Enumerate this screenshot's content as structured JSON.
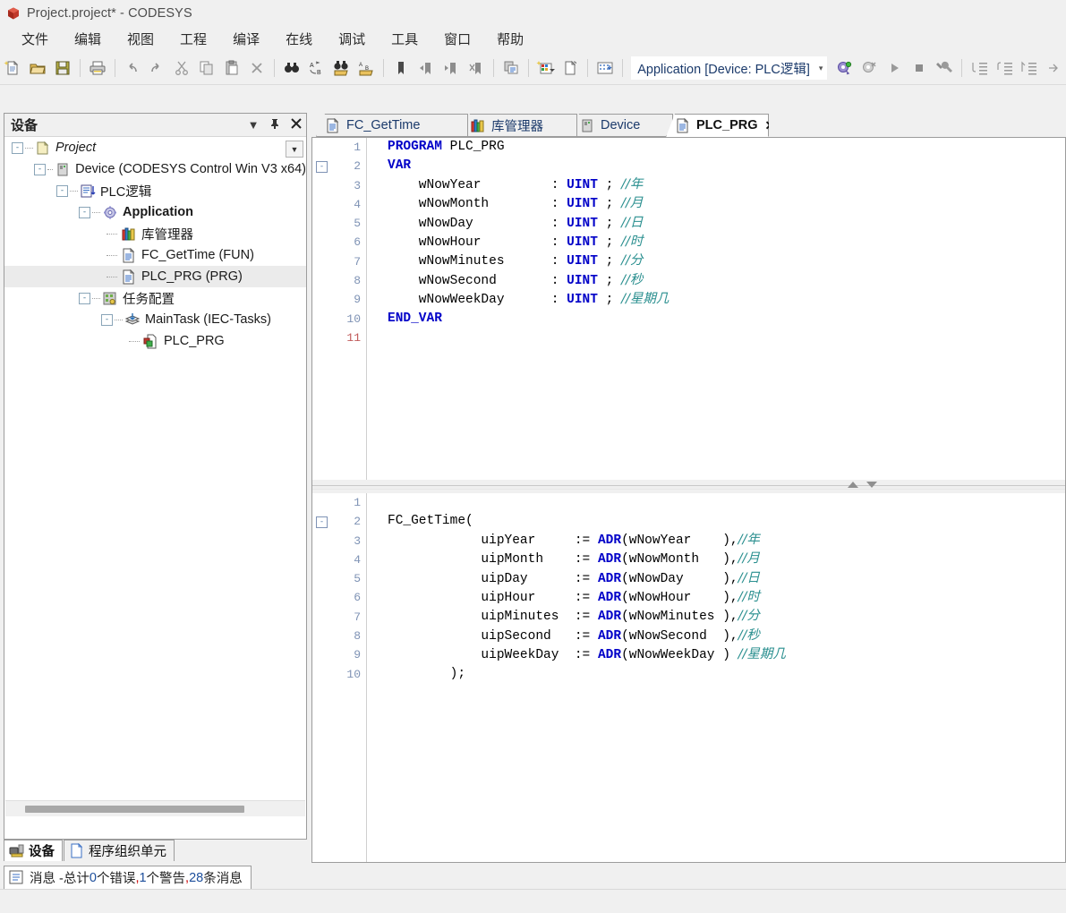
{
  "window": {
    "title": "Project.project* - CODESYS",
    "icon": "codesys-logo-icon"
  },
  "menu": {
    "items": [
      {
        "label": "文件",
        "name": "menu-file"
      },
      {
        "label": "编辑",
        "name": "menu-edit"
      },
      {
        "label": "视图",
        "name": "menu-view"
      },
      {
        "label": "工程",
        "name": "menu-project"
      },
      {
        "label": "编译",
        "name": "menu-build"
      },
      {
        "label": "在线",
        "name": "menu-online"
      },
      {
        "label": "调试",
        "name": "menu-debug"
      },
      {
        "label": "工具",
        "name": "menu-tools"
      },
      {
        "label": "窗口",
        "name": "menu-window"
      },
      {
        "label": "帮助",
        "name": "menu-help"
      }
    ]
  },
  "toolbar": {
    "application_selector": "Application [Device: PLC逻辑]",
    "caret": "▾",
    "buttons": [
      "new-project-icon",
      "open-project-icon",
      "save-project-icon",
      "print-icon",
      "undo-icon",
      "redo-icon",
      "cut-icon",
      "copy-icon",
      "paste-icon",
      "delete-icon",
      "find-icon",
      "replace-icon",
      "find-next-icon",
      "find-prev-icon",
      "toggle-bookmark-icon",
      "next-bookmark-icon",
      "prev-bookmark-icon",
      "clear-bookmarks-icon",
      "paste-special-icon",
      "new-object-icon",
      "new-folder-icon",
      "display-mode-icon",
      "login-icon",
      "logout-icon",
      "start-icon",
      "stop-icon",
      "build-icon",
      "step-into-icon",
      "step-over-icon",
      "step-out-icon"
    ]
  },
  "devices_panel": {
    "title": "设备",
    "header_buttons": [
      "dropdown-icon",
      "pin-icon",
      "close-icon"
    ],
    "tree": [
      {
        "label": "Project",
        "icon": "project-icon",
        "indent": 0,
        "expander": "-",
        "style": "italic",
        "name": "tree-item-project"
      },
      {
        "label": "Device (CODESYS Control Win V3 x64)",
        "icon": "device-icon",
        "indent": 1,
        "expander": "-",
        "style": "normal",
        "name": "tree-item-device"
      },
      {
        "label": "PLC逻辑",
        "icon": "plc-logic-icon",
        "indent": 2,
        "expander": "-",
        "style": "normal",
        "name": "tree-item-plc-logic"
      },
      {
        "label": "Application",
        "icon": "application-icon",
        "indent": 3,
        "expander": "-",
        "style": "bold",
        "name": "tree-item-application"
      },
      {
        "label": "库管理器",
        "icon": "library-manager-icon",
        "indent": 4,
        "expander": "",
        "style": "normal",
        "name": "tree-item-library-manager"
      },
      {
        "label": "FC_GetTime (FUN)",
        "icon": "function-icon",
        "indent": 4,
        "expander": "",
        "style": "normal",
        "name": "tree-item-fc-gettime"
      },
      {
        "label": "PLC_PRG (PRG)",
        "icon": "program-icon",
        "indent": 4,
        "expander": "",
        "style": "normal",
        "selected": true,
        "name": "tree-item-plc-prg"
      },
      {
        "label": "任务配置",
        "icon": "task-config-icon",
        "indent": 3,
        "expander": "-",
        "style": "normal",
        "name": "tree-item-task-config"
      },
      {
        "label": "MainTask (IEC-Tasks)",
        "icon": "task-icon",
        "indent": 4,
        "expander": "-",
        "style": "normal",
        "name": "tree-item-maintask"
      },
      {
        "label": "PLC_PRG",
        "icon": "task-call-icon",
        "indent": 5,
        "expander": "",
        "style": "normal",
        "name": "tree-item-maintask-plc-prg"
      }
    ]
  },
  "dock_tabs": [
    {
      "label": "设备",
      "icon": "devices-icon",
      "active": true,
      "name": "dock-tab-devices"
    },
    {
      "label": "程序组织单元",
      "icon": "pou-icon",
      "active": false,
      "name": "dock-tab-pou"
    }
  ],
  "messages_tab": {
    "icon": "messages-icon",
    "prefix": "消息 -总计 ",
    "errors": "0",
    "errors_suffix": "个错误",
    "sep1": ",",
    "warnings": "1",
    "warnings_suffix": "个警告",
    "sep2": ",",
    "messages": "28",
    "messages_suffix": "条消息"
  },
  "editor": {
    "tabs": [
      {
        "label": "FC_GetTime",
        "icon": "function-icon",
        "active": false,
        "closable": false,
        "name": "editor-tab-fc-gettime"
      },
      {
        "label": "库管理器",
        "icon": "library-manager-icon",
        "active": false,
        "closable": false,
        "name": "editor-tab-library-manager"
      },
      {
        "label": "Device",
        "icon": "device-icon",
        "active": false,
        "closable": false,
        "name": "editor-tab-device"
      },
      {
        "label": "PLC_PRG",
        "icon": "program-icon",
        "active": true,
        "closable": true,
        "close_label": "✕",
        "name": "editor-tab-plc-prg"
      }
    ],
    "declaration": {
      "fold_marker": "-",
      "fold_line": 2,
      "current_line": 11,
      "lines": [
        {
          "n": "1",
          "tokens": [
            {
              "t": "k",
              "v": "PROGRAM"
            },
            {
              "t": "id",
              "v": " PLC_PRG"
            }
          ]
        },
        {
          "n": "2",
          "tokens": [
            {
              "t": "k",
              "v": "VAR"
            }
          ]
        },
        {
          "n": "3",
          "tokens": [
            {
              "t": "id",
              "v": "    wNowYear         "
            },
            {
              "t": "op",
              "v": ": "
            },
            {
              "t": "t",
              "v": "UINT"
            },
            {
              "t": "op",
              "v": " ; "
            },
            {
              "t": "cmz",
              "v": "//年"
            }
          ]
        },
        {
          "n": "4",
          "tokens": [
            {
              "t": "id",
              "v": "    wNowMonth        "
            },
            {
              "t": "op",
              "v": ": "
            },
            {
              "t": "t",
              "v": "UINT"
            },
            {
              "t": "op",
              "v": " ; "
            },
            {
              "t": "cmz",
              "v": "//月"
            }
          ]
        },
        {
          "n": "5",
          "tokens": [
            {
              "t": "id",
              "v": "    wNowDay          "
            },
            {
              "t": "op",
              "v": ": "
            },
            {
              "t": "t",
              "v": "UINT"
            },
            {
              "t": "op",
              "v": " ; "
            },
            {
              "t": "cmz",
              "v": "//日"
            }
          ]
        },
        {
          "n": "6",
          "tokens": [
            {
              "t": "id",
              "v": "    wNowHour         "
            },
            {
              "t": "op",
              "v": ": "
            },
            {
              "t": "t",
              "v": "UINT"
            },
            {
              "t": "op",
              "v": " ; "
            },
            {
              "t": "cmz",
              "v": "//时"
            }
          ]
        },
        {
          "n": "7",
          "tokens": [
            {
              "t": "id",
              "v": "    wNowMinutes      "
            },
            {
              "t": "op",
              "v": ": "
            },
            {
              "t": "t",
              "v": "UINT"
            },
            {
              "t": "op",
              "v": " ; "
            },
            {
              "t": "cmz",
              "v": "//分"
            }
          ]
        },
        {
          "n": "8",
          "tokens": [
            {
              "t": "id",
              "v": "    wNowSecond       "
            },
            {
              "t": "op",
              "v": ": "
            },
            {
              "t": "t",
              "v": "UINT"
            },
            {
              "t": "op",
              "v": " ; "
            },
            {
              "t": "cmz",
              "v": "//秒"
            }
          ]
        },
        {
          "n": "9",
          "tokens": [
            {
              "t": "id",
              "v": "    wNowWeekDay      "
            },
            {
              "t": "op",
              "v": ": "
            },
            {
              "t": "t",
              "v": "UINT"
            },
            {
              "t": "op",
              "v": " ; "
            },
            {
              "t": "cmz",
              "v": "//星期几"
            }
          ]
        },
        {
          "n": "10",
          "tokens": [
            {
              "t": "k",
              "v": "END_VAR"
            }
          ]
        },
        {
          "n": "11",
          "tokens": []
        }
      ]
    },
    "implementation": {
      "fold_marker": "-",
      "fold_line": 2,
      "lines": [
        {
          "n": "1",
          "tokens": []
        },
        {
          "n": "2",
          "tokens": [
            {
              "t": "fn",
              "v": "FC_GetTime("
            }
          ]
        },
        {
          "n": "3",
          "tokens": [
            {
              "t": "id",
              "v": "            uipYear     "
            },
            {
              "t": "op",
              "v": ":= "
            },
            {
              "t": "ad",
              "v": "ADR"
            },
            {
              "t": "op",
              "v": "("
            },
            {
              "t": "id",
              "v": "wNowYear    "
            },
            {
              "t": "op",
              "v": "),"
            },
            {
              "t": "cmz",
              "v": "//年"
            }
          ]
        },
        {
          "n": "4",
          "tokens": [
            {
              "t": "id",
              "v": "            uipMonth    "
            },
            {
              "t": "op",
              "v": ":= "
            },
            {
              "t": "ad",
              "v": "ADR"
            },
            {
              "t": "op",
              "v": "("
            },
            {
              "t": "id",
              "v": "wNowMonth   "
            },
            {
              "t": "op",
              "v": "),"
            },
            {
              "t": "cmz",
              "v": "//月"
            }
          ]
        },
        {
          "n": "5",
          "tokens": [
            {
              "t": "id",
              "v": "            uipDay      "
            },
            {
              "t": "op",
              "v": ":= "
            },
            {
              "t": "ad",
              "v": "ADR"
            },
            {
              "t": "op",
              "v": "("
            },
            {
              "t": "id",
              "v": "wNowDay     "
            },
            {
              "t": "op",
              "v": "),"
            },
            {
              "t": "cmz",
              "v": "//日"
            }
          ]
        },
        {
          "n": "6",
          "tokens": [
            {
              "t": "id",
              "v": "            uipHour     "
            },
            {
              "t": "op",
              "v": ":= "
            },
            {
              "t": "ad",
              "v": "ADR"
            },
            {
              "t": "op",
              "v": "("
            },
            {
              "t": "id",
              "v": "wNowHour    "
            },
            {
              "t": "op",
              "v": "),"
            },
            {
              "t": "cmz",
              "v": "//时"
            }
          ]
        },
        {
          "n": "7",
          "tokens": [
            {
              "t": "id",
              "v": "            uipMinutes  "
            },
            {
              "t": "op",
              "v": ":= "
            },
            {
              "t": "ad",
              "v": "ADR"
            },
            {
              "t": "op",
              "v": "("
            },
            {
              "t": "id",
              "v": "wNowMinutes "
            },
            {
              "t": "op",
              "v": "),"
            },
            {
              "t": "cmz",
              "v": "//分"
            }
          ]
        },
        {
          "n": "8",
          "tokens": [
            {
              "t": "id",
              "v": "            uipSecond   "
            },
            {
              "t": "op",
              "v": ":= "
            },
            {
              "t": "ad",
              "v": "ADR"
            },
            {
              "t": "op",
              "v": "("
            },
            {
              "t": "id",
              "v": "wNowSecond  "
            },
            {
              "t": "op",
              "v": "),"
            },
            {
              "t": "cmz",
              "v": "//秒"
            }
          ]
        },
        {
          "n": "9",
          "tokens": [
            {
              "t": "id",
              "v": "            uipWeekDay  "
            },
            {
              "t": "op",
              "v": ":= "
            },
            {
              "t": "ad",
              "v": "ADR"
            },
            {
              "t": "op",
              "v": "("
            },
            {
              "t": "id",
              "v": "wNowWeekDay "
            },
            {
              "t": "op",
              "v": ") "
            },
            {
              "t": "cmz",
              "v": "//星期几"
            }
          ]
        },
        {
          "n": "10",
          "tokens": [
            {
              "t": "op",
              "v": "        );"
            }
          ]
        }
      ]
    },
    "splitter": {
      "up_arrow": "▲",
      "down_arrow": "▼"
    }
  },
  "colors": {
    "keyword": "#0000c8",
    "comment": "#2a8f8f",
    "linenumber": "#7f93b5",
    "current_linenumber": "#c05a5a",
    "chrome": "#f0f0f0",
    "selection": "#ebebeb",
    "tab_text": "#1b3a6b"
  }
}
